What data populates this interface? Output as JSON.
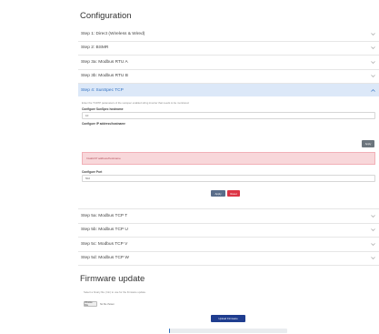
{
  "configuration": {
    "title": "Configuration",
    "steps_before": [
      {
        "label": "Step 1: Direct (Wireless & Wired)"
      },
      {
        "label": "Step 2: BSMR"
      },
      {
        "label": "Step 3a: Modbus RTU A"
      },
      {
        "label": "Step 3b: Modbus RTU B"
      }
    ],
    "active_step": {
      "label": "Step 4: SunSpec TCP",
      "help_text": "Enter the TCP/IP parameters of the sunspec enabled string inverter that needs to be monitored.",
      "hostname_label": "Configure SunSpec hostname",
      "hostname_value": "10",
      "ip_label": "Configure IP address/hostname",
      "ip_value": "",
      "apply_small_label": "Apply",
      "alert_text": "Invalid IP address/hostname",
      "port_label": "Configure Port",
      "port_value": "502",
      "apply_label": "Apply",
      "reset_label": "Reset"
    },
    "steps_after": [
      {
        "label": "Step 5a: Modbus TCP T"
      },
      {
        "label": "Step 5b: Modbus TCP U"
      },
      {
        "label": "Step 5c: Modbus TCP V"
      },
      {
        "label": "Step 5d: Modbus TCP W"
      }
    ]
  },
  "firmware": {
    "title": "Firmware update",
    "help_text": "Select a binary file (.bin) to use for the firmware update.",
    "choose_label": "Choose File",
    "no_file_label": "No file chosen",
    "upload_label": "Upload Firmware",
    "progress_fraction": 0.01
  },
  "colors": {
    "accent": "#2f6fc0",
    "active_bg": "#dce8f8",
    "alert_bg": "#f8d7da",
    "reset": "#dc3545",
    "upload": "#1f3d8f"
  },
  "icons": {
    "chevron_down": "chevron-down-icon",
    "chevron_up": "chevron-up-icon"
  }
}
